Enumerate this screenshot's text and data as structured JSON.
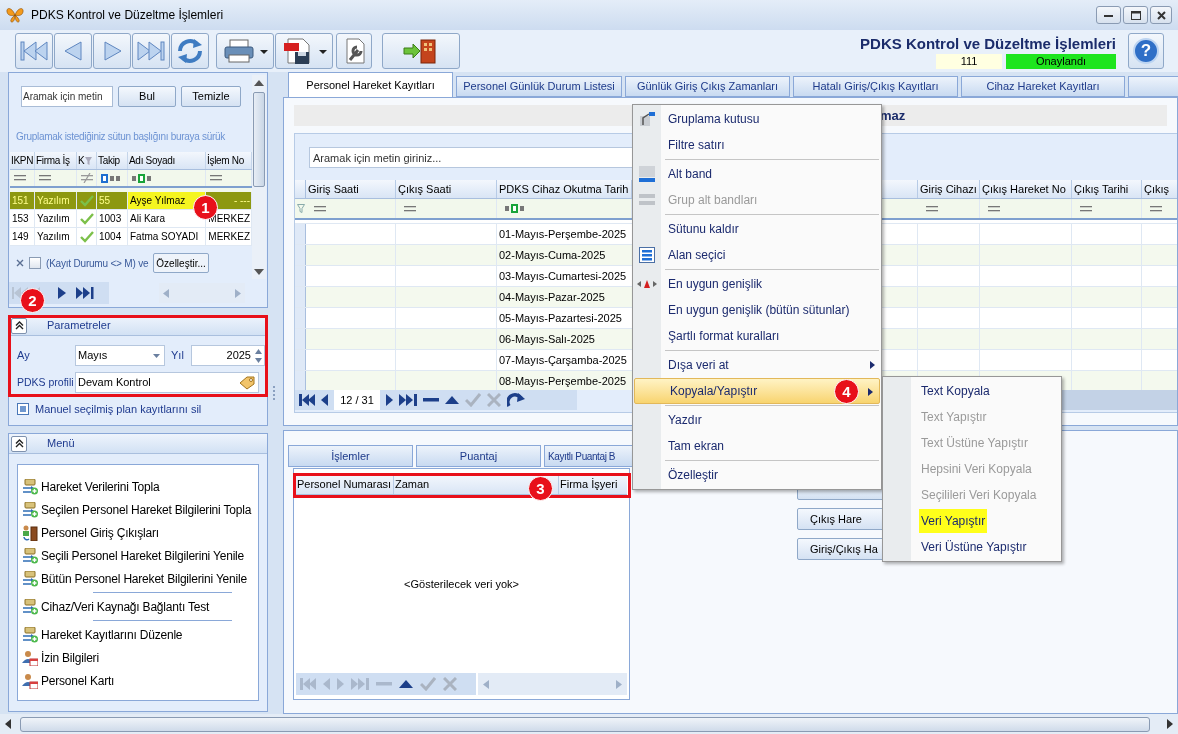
{
  "window": {
    "title": "PDKS Kontrol ve Düzeltme İşlemleri"
  },
  "header": {
    "title": "PDKS Kontrol ve Düzeltme İşlemleri",
    "code": "111",
    "status": "Onaylandı",
    "help": "?"
  },
  "left_grid": {
    "search": {
      "placeholder": "Aramak için metin"
    },
    "buttons": [
      "Bul",
      "Temizle"
    ],
    "group_hint": "Gruplamak istediğiniz sütun başlığını buraya sürük",
    "columns": [
      {
        "label": "IKPN",
        "kind": "equals"
      },
      {
        "label": "Firma İş",
        "kind": "equals"
      },
      {
        "label": "K",
        "kind": "not_equals"
      },
      {
        "label": "Takip",
        "kind": "begins"
      },
      {
        "label": "Adı Soyadı",
        "kind": "contains"
      },
      {
        "label": "İşlem No",
        "kind": "equals"
      }
    ],
    "rows": [
      {
        "selected": true,
        "checked": true,
        "cells": [
          "151",
          "Yazılım",
          "",
          "55",
          "Ayşe Yılmaz",
          "- ---"
        ]
      },
      {
        "selected": false,
        "checked": true,
        "cells": [
          "153",
          "Yazılım",
          "",
          "1003",
          "Ali Kara",
          "MERKEZ"
        ]
      },
      {
        "selected": false,
        "checked": true,
        "cells": [
          "149",
          "Yazılım",
          "",
          "1004",
          "Fatma SOYADI",
          "MERKEZ"
        ]
      }
    ],
    "filter": {
      "enabled": false,
      "text": "(Kayıt Durumu <> M) ve",
      "button": "Özelleştir..."
    }
  },
  "parameters": {
    "title": "Parametreler",
    "month_label": "Ay",
    "month": "Mayıs",
    "year_label": "Yıl",
    "year": "2025",
    "profile_label": "PDKS profili",
    "profile": "Devam Kontrol",
    "option": "Manuel seçilmiş plan kayıtlarını sil"
  },
  "menu": {
    "title": "Menü",
    "items": [
      {
        "kind": "transfer",
        "label": "Hareket Verilerini Topla"
      },
      {
        "kind": "transfer",
        "label": "Seçilen Personel Hareket Bilgilerini Topla"
      },
      {
        "kind": "door",
        "label": "Personel Giriş Çıkışları"
      },
      {
        "kind": "transfer",
        "label": "Seçili Personel Hareket Bilgilerini Yenile"
      },
      {
        "kind": "transfer",
        "label": "Bütün Personel Hareket Bilgilerini Yenile"
      },
      {
        "kind": "separator"
      },
      {
        "kind": "transfer",
        "label": "Cihaz/Veri Kaynağı Bağlantı Test"
      },
      {
        "kind": "separator"
      },
      {
        "kind": "transfer",
        "label": "Hareket Kayıtlarını Düzenle"
      },
      {
        "kind": "card",
        "label": "İzin Bilgileri"
      },
      {
        "kind": "card",
        "label": "Personel Kartı"
      }
    ]
  },
  "main_tabs": [
    {
      "label": "Personel Hareket Kayıtları",
      "selected": true
    },
    {
      "label": "Personel Günlük Durum Listesi",
      "selected": false
    },
    {
      "label": "Günlük Giriş Çıkış Zamanları",
      "selected": false
    },
    {
      "label": "Hatalı Giriş/Çıkış Kayıtları",
      "selected": false
    },
    {
      "label": "Cihaz Hareket Kayıtları",
      "selected": false
    }
  ],
  "record_header": "maz",
  "grid": {
    "search": {
      "placeholder": "Aramak için metin giriniz..."
    },
    "columns_left": [
      {
        "label": "Giriş Saati",
        "kind": "equals"
      },
      {
        "label": "Çıkış Saati",
        "kind": "equals"
      },
      {
        "label": "PDKS Cihaz Okutma Tarih",
        "kind": "contains"
      }
    ],
    "columns_right": [
      {
        "label": "Giriş Cihazı",
        "kind": "equals"
      },
      {
        "label": "Çıkış Hareket No",
        "kind": "equals"
      },
      {
        "label": "Çıkış Tarihi",
        "kind": "equals"
      },
      {
        "label": "Çıkış",
        "kind": "equals"
      }
    ],
    "rows": [
      "01-Mayıs-Perşembe-2025",
      "02-Mayıs-Cuma-2025",
      "03-Mayıs-Cumartesi-2025",
      "04-Mayıs-Pazar-2025",
      "05-Mayıs-Pazartesi-2025",
      "06-Mayıs-Salı-2025",
      "07-Mayıs-Çarşamba-2025",
      "08-Mayıs-Perşembe-2025"
    ],
    "position": "12 / 31"
  },
  "bottom_tabs": [
    {
      "label": "İşlemler",
      "selected": false
    },
    {
      "label": "Puantaj",
      "selected": false
    },
    {
      "label": "Kayıtlı Puantaj B",
      "selected": false
    }
  ],
  "detail_grid": {
    "columns": [
      "Personel Numarası",
      "Zaman",
      "Firma İşyeri"
    ],
    "empty": "<Gösterilecek veri yok>"
  },
  "side_buttons": [
    "Çıkış Hare",
    "Giriş/Çıkış Ha"
  ],
  "context_menu": {
    "items": [
      {
        "kind": "group_box",
        "label": "Gruplama kutusu",
        "disabled": false,
        "highlighted": false,
        "submenu": false
      },
      {
        "kind": "plain",
        "label": "Filtre satırı",
        "disabled": false,
        "highlighted": false,
        "submenu": false
      },
      {
        "kind": "separator"
      },
      {
        "kind": "footer",
        "label": "Alt band",
        "disabled": false,
        "highlighted": false,
        "submenu": false
      },
      {
        "kind": "group_footers",
        "label": "Grup alt bandları",
        "disabled": true,
        "highlighted": false,
        "submenu": false
      },
      {
        "kind": "separator"
      },
      {
        "kind": "plain",
        "label": "Sütunu kaldır",
        "disabled": false,
        "highlighted": false,
        "submenu": false
      },
      {
        "kind": "field_chooser",
        "label": "Alan seçici",
        "disabled": false,
        "highlighted": false,
        "submenu": false
      },
      {
        "kind": "separator"
      },
      {
        "kind": "best_fit",
        "label": "En uygun genişlik",
        "disabled": false,
        "highlighted": false,
        "submenu": false
      },
      {
        "kind": "plain",
        "label": "En uygun genişlik (bütün sütunlar)",
        "disabled": false,
        "highlighted": false,
        "submenu": false
      },
      {
        "kind": "plain",
        "label": "Şartlı format kuralları",
        "disabled": false,
        "highlighted": false,
        "submenu": false
      },
      {
        "kind": "separator"
      },
      {
        "kind": "plain",
        "label": "Dışa veri at",
        "disabled": false,
        "highlighted": false,
        "submenu": true
      },
      {
        "kind": "plain",
        "label": "Kopyala/Yapıştır",
        "disabled": false,
        "highlighted": true,
        "submenu": true
      },
      {
        "kind": "separator"
      },
      {
        "kind": "plain",
        "label": "Yazdır",
        "disabled": false,
        "highlighted": false,
        "submenu": false
      },
      {
        "kind": "plain",
        "label": "Tam ekran",
        "disabled": false,
        "highlighted": false,
        "submenu": false
      },
      {
        "kind": "separator"
      },
      {
        "kind": "plain",
        "label": "Özelleştir",
        "disabled": false,
        "highlighted": false,
        "submenu": false
      }
    ]
  },
  "submenu": {
    "items": [
      {
        "label": "Text Kopyala",
        "disabled": false,
        "marked": false
      },
      {
        "label": "Text Yapıştır",
        "disabled": true,
        "marked": false
      },
      {
        "label": "Text Üstüne Yapıştır",
        "disabled": true,
        "marked": false
      },
      {
        "label": "Hepsini Veri Kopyala",
        "disabled": true,
        "marked": false
      },
      {
        "label": "Seçilileri Veri Kopyala",
        "disabled": true,
        "marked": false
      },
      {
        "label": "Veri Yapıştır",
        "disabled": false,
        "marked": true
      },
      {
        "label": "Veri Üstüne Yapıştır",
        "disabled": false,
        "marked": false
      }
    ]
  },
  "badges": [
    "1",
    "2",
    "3",
    "4"
  ]
}
